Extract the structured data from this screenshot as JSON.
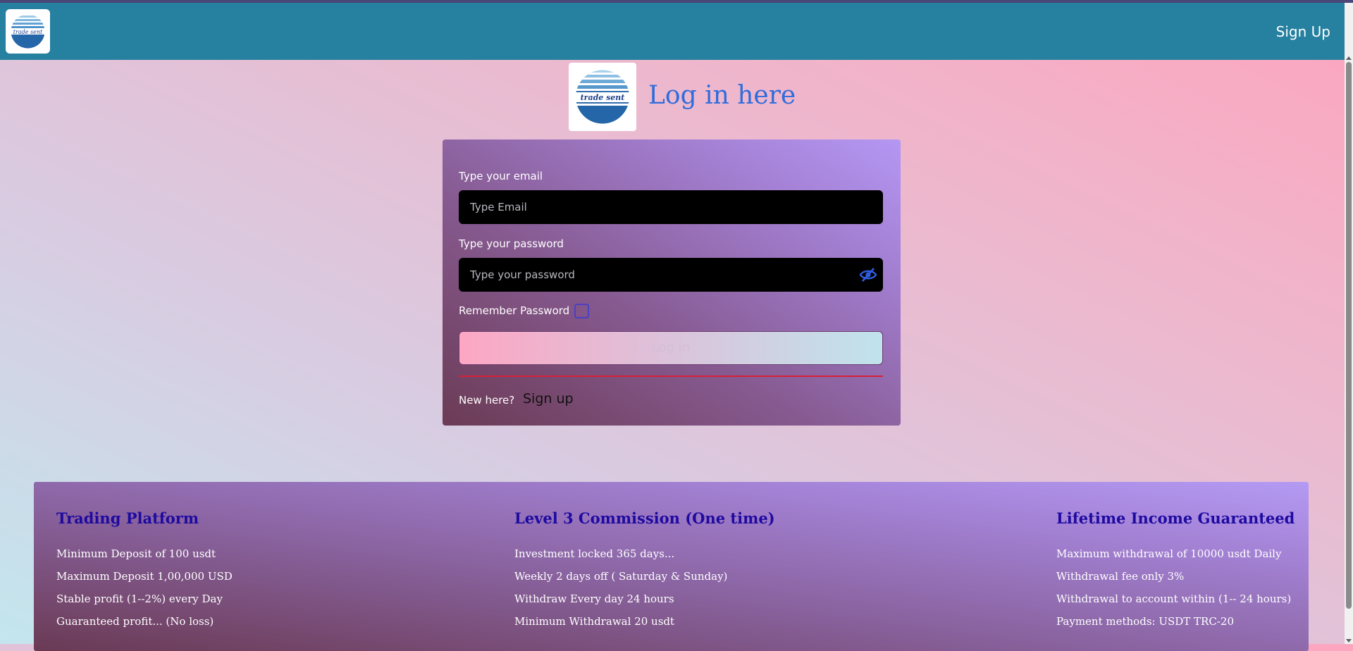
{
  "navbar": {
    "logo_text": "trade sent",
    "signup_label": "Sign Up"
  },
  "header": {
    "logo_text": "trade sent",
    "title": "Log in here"
  },
  "login_form": {
    "email_label": "Type your email",
    "email_placeholder": "Type Email",
    "email_value": "",
    "password_label": "Type your password",
    "password_placeholder": "Type your password",
    "password_value": "",
    "remember_label": "Remember Password",
    "remember_checked": false,
    "login_button_label": "Log in",
    "new_here_label": "New here?",
    "signup_link_label": "Sign up"
  },
  "info": {
    "columns": [
      {
        "title": "Trading Platform",
        "items": [
          "Minimum Deposit of 100 usdt",
          "Maximum Deposit 1,00,000 USD",
          "Stable profit (1--2%) every Day",
          "Guaranteed profit... (No loss)"
        ]
      },
      {
        "title": "Level 3 Commission (One time)",
        "items": [
          "Investment locked 365 days...",
          "Weekly 2 days off ( Saturday & Sunday)",
          "Withdraw Every day 24 hours",
          "Minimum Withdrawal 20 usdt"
        ]
      },
      {
        "title": "Lifetime Income Guaranteed",
        "items": [
          "Maximum withdrawal of 10000 usdt Daily",
          "Withdrawal fee only 3%",
          "Withdrawal to account within (1-- 24 hours)",
          "Payment methods: USDT TRC-20"
        ]
      }
    ]
  },
  "colors": {
    "navbar": "#26809f",
    "heading": "#2f6cdc",
    "column_title": "#1e0aa0",
    "divider": "#d62038"
  },
  "icons": [
    "trade-sent-logo",
    "eye-slash-icon"
  ]
}
